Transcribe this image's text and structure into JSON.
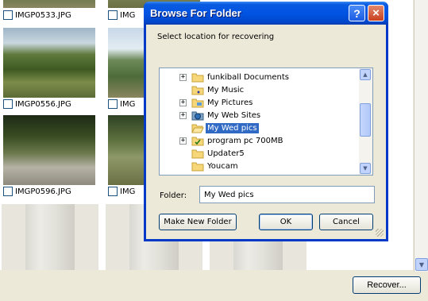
{
  "thumbnails": [
    {
      "caption": "IMGP0533.JPG"
    },
    {
      "caption": "IMGP0556.JPG"
    },
    {
      "caption": "IMGP0596.JPG"
    }
  ],
  "thumbnails_col2_partial": [
    {
      "caption": "IMG"
    },
    {
      "caption": "IMG"
    },
    {
      "caption": "IMG"
    }
  ],
  "recover_button": "Recover...",
  "dialog": {
    "title": "Browse For Folder",
    "help_glyph": "?",
    "close_glyph": "×",
    "prompt": "Select location for recovering",
    "tree": [
      {
        "label": "funkiball Documents",
        "expandable": true,
        "icon": "folder-icon"
      },
      {
        "label": "My Music",
        "expandable": false,
        "icon": "music-folder-icon"
      },
      {
        "label": "My Pictures",
        "expandable": true,
        "icon": "pictures-folder-icon"
      },
      {
        "label": "My Web Sites",
        "expandable": true,
        "icon": "web-folder-icon"
      },
      {
        "label": "My Wed pics",
        "expandable": false,
        "icon": "folder-open-icon",
        "selected": true
      },
      {
        "label": "program pc 700MB",
        "expandable": true,
        "icon": "checked-folder-icon"
      },
      {
        "label": "Updater5",
        "expandable": false,
        "icon": "folder-icon"
      },
      {
        "label": "Youcam",
        "expandable": false,
        "icon": "folder-icon"
      }
    ],
    "folder_label": "Folder:",
    "folder_value": "My Wed pics",
    "make_new_folder": "Make New Folder",
    "ok": "OK",
    "cancel": "Cancel"
  },
  "colors": {
    "titlebar": "#0054e3",
    "selection": "#316ac5",
    "dialog_face": "#ece9d8"
  }
}
